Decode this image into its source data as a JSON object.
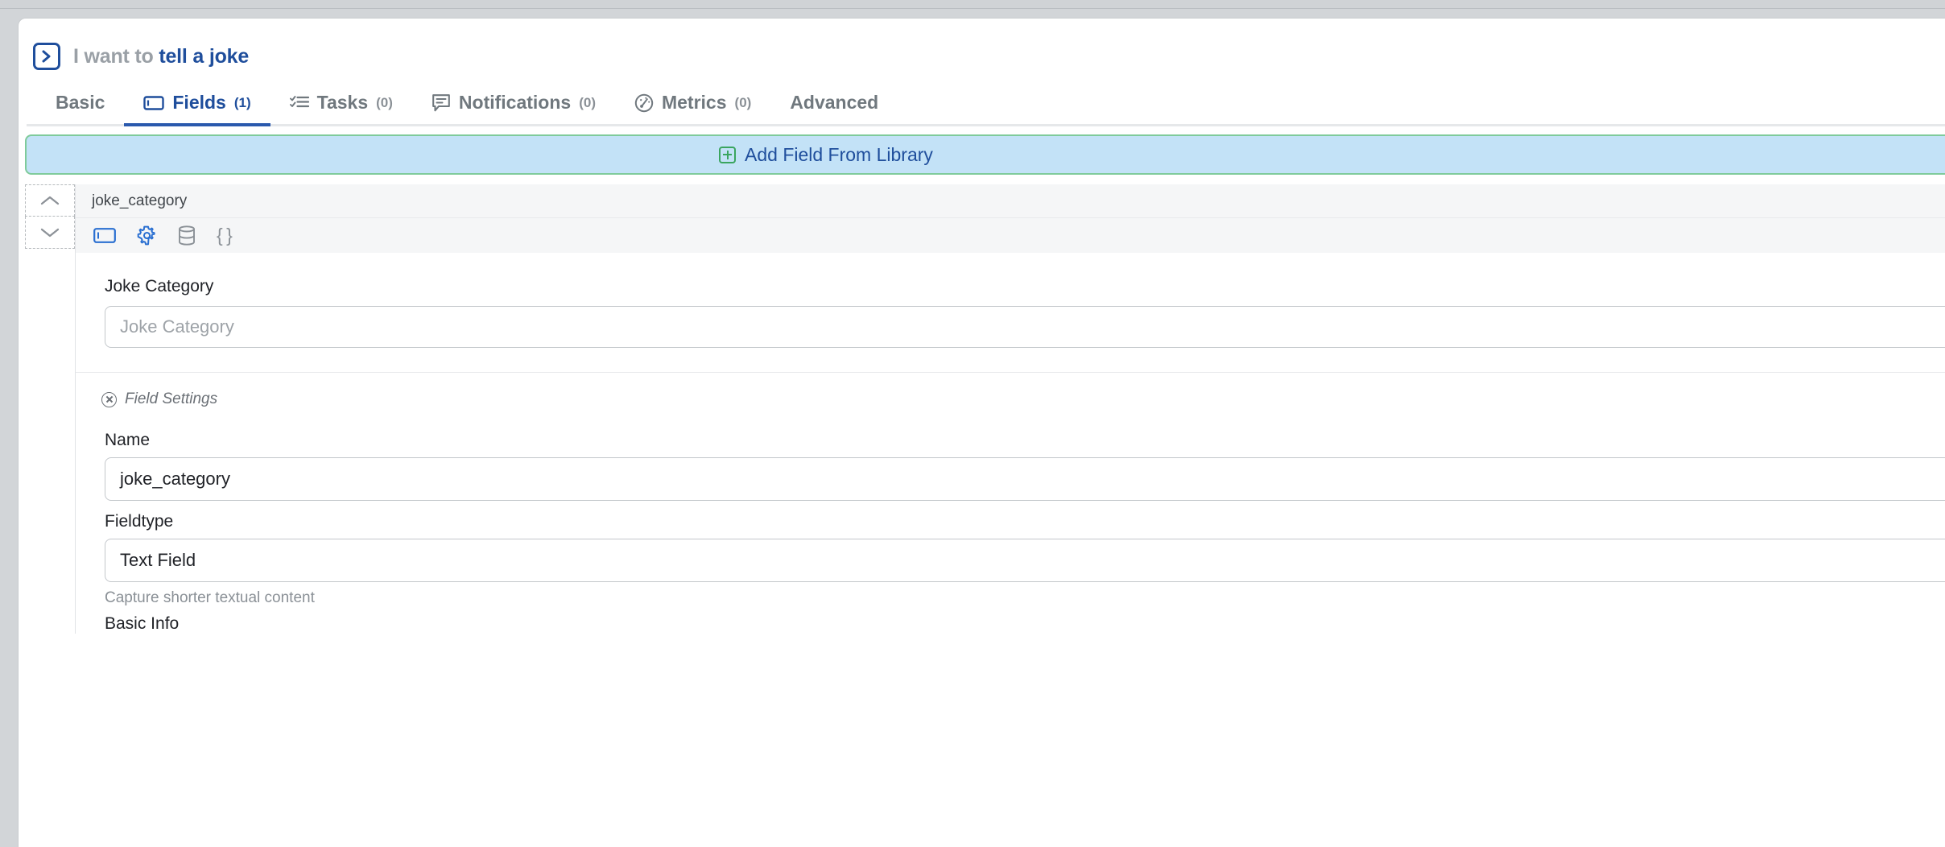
{
  "header": {
    "icon": "chevron-in-box-icon",
    "prefix": "I want to",
    "subject": "tell a joke"
  },
  "tabs": [
    {
      "label": "Basic",
      "count": "",
      "icon": "none",
      "active": false
    },
    {
      "label": "Fields",
      "count": "(1)",
      "icon": "text-field-icon",
      "active": true
    },
    {
      "label": "Tasks",
      "count": "(0)",
      "icon": "checklist-icon",
      "active": false
    },
    {
      "label": "Notifications",
      "count": "(0)",
      "icon": "speech-bubble-icon",
      "active": false
    },
    {
      "label": "Metrics",
      "count": "(0)",
      "icon": "gauge-icon",
      "active": false
    },
    {
      "label": "Advanced",
      "count": "",
      "icon": "none",
      "active": false
    }
  ],
  "library_bar": {
    "label": "Add Field From Library",
    "icon": "plus-square-icon",
    "background": "#c3e2f7",
    "border_color": "#7fcb9b",
    "text_color": "#1f4e9c"
  },
  "field": {
    "name_header": "joke_category",
    "toolbar_icons": [
      {
        "name": "text-field-icon",
        "state": "active"
      },
      {
        "name": "gear-icon",
        "state": "active"
      },
      {
        "name": "database-icon",
        "state": "inactive"
      },
      {
        "name": "curly-braces-icon",
        "state": "inactive"
      }
    ],
    "reorder": {
      "up": "chevron-up-icon",
      "down": "chevron-down-icon"
    },
    "preview": {
      "label": "Joke Category",
      "placeholder": "Joke Category",
      "value": ""
    },
    "settings": {
      "title": "Field Settings",
      "icon": "circle-x-icon",
      "name_label": "Name",
      "name_value": "joke_category",
      "fieldtype_label": "Fieldtype",
      "fieldtype_value": "Text Field",
      "fieldtype_help": "Capture shorter textual content",
      "basic_info_heading": "Basic Info"
    }
  },
  "colors": {
    "accent_blue": "#1f4e9c",
    "tab_underline": "#2a59ad",
    "green_border": "#7fcb9b",
    "light_blue_fill": "#c3e2f7",
    "muted_text": "#8a9096"
  }
}
